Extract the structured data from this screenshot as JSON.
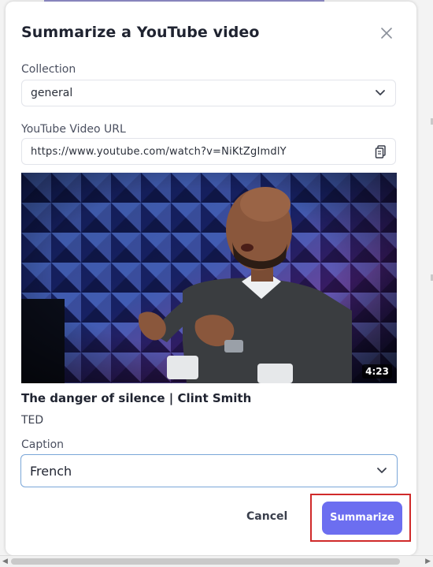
{
  "dialog": {
    "title": "Summarize a YouTube video",
    "close_icon": "close-icon"
  },
  "collection": {
    "label": "Collection",
    "value": "general",
    "icon": "chevron-down-icon"
  },
  "url": {
    "label": "YouTube Video URL",
    "value": "https://www.youtube.com/watch?v=NiKtZgImdlY",
    "icon": "clipboard-icon"
  },
  "video": {
    "duration": "4:23",
    "title": "The danger of silence | Clint Smith",
    "channel": "TED"
  },
  "caption": {
    "label": "Caption",
    "value": "French",
    "icon": "chevron-down-icon"
  },
  "actions": {
    "cancel_label": "Cancel",
    "summarize_label": "Summarize",
    "primary_color": "#6c6ef0",
    "highlight_color": "#d02a2a"
  }
}
